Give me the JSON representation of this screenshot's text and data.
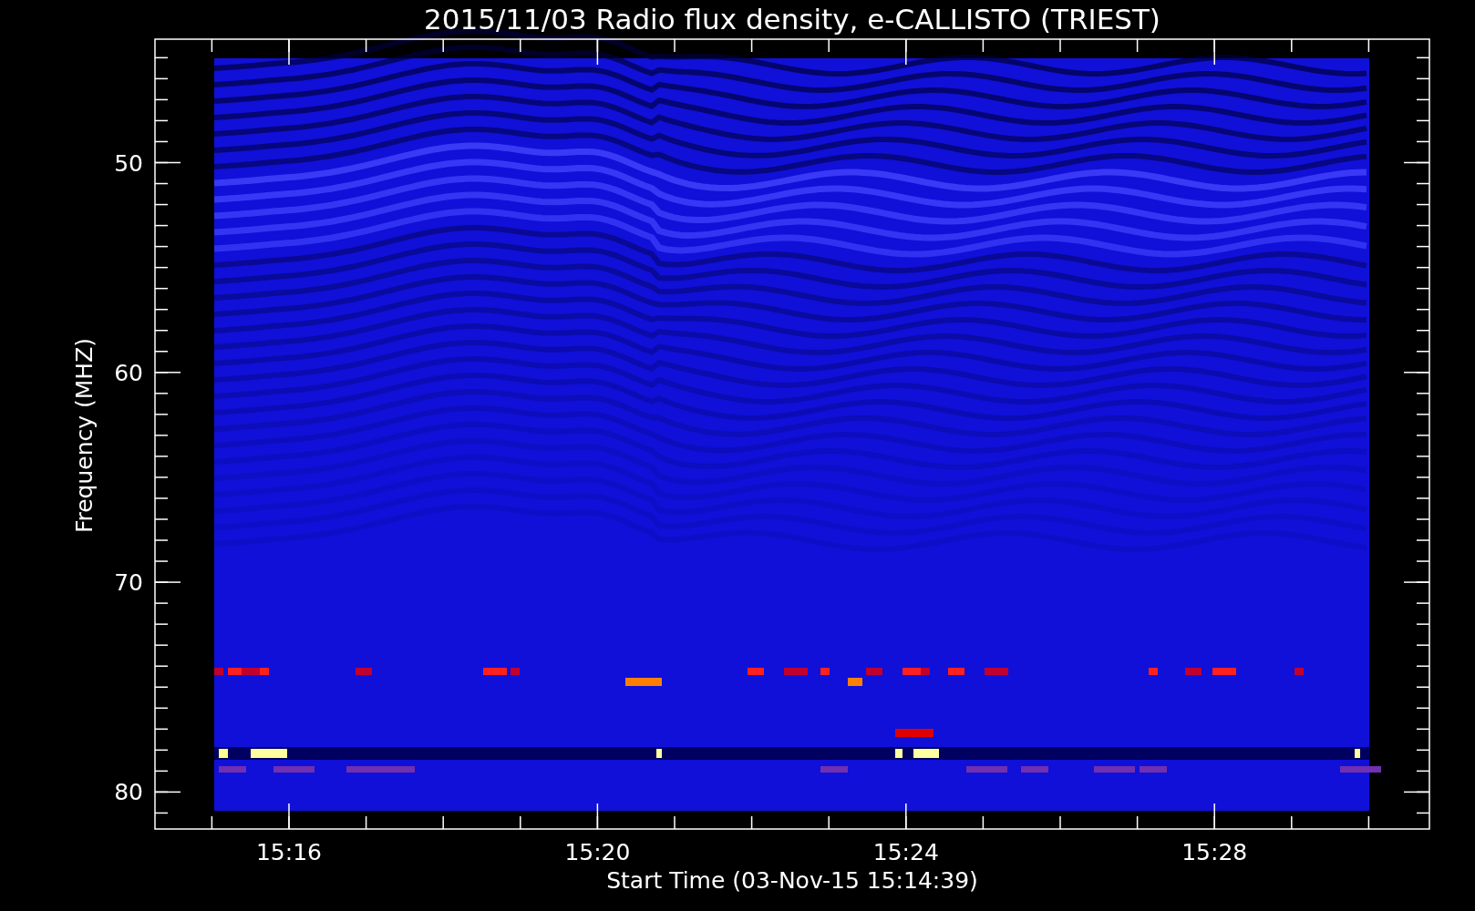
{
  "chart": {
    "title": "2015/11/03  Radio flux density, e-CALLISTO (TRIEST)",
    "y_axis": {
      "label": "Frequency (MHZ)",
      "ticks": [
        "50",
        "60",
        "70",
        "80"
      ]
    },
    "x_axis": {
      "label": "Start Time (03-Nov-15 15:14:39)",
      "ticks": [
        "15:16",
        "15:20",
        "15:24",
        "15:28"
      ]
    }
  }
}
